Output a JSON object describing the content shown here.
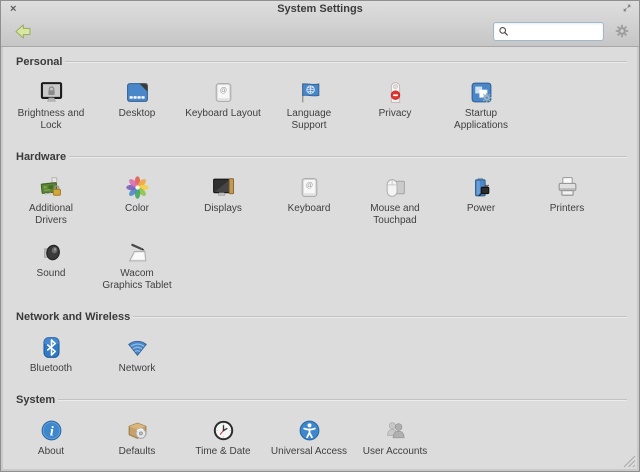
{
  "window": {
    "title": "System Settings",
    "close_glyph": "×"
  },
  "toolbar": {
    "search_value": ""
  },
  "colors": {
    "window_bg": "#dcdcdc",
    "chrome_top": "#dedede",
    "chrome_bottom": "#c6c6c6",
    "header_text": "#3a3a3a",
    "icon_blue": "#4a87c8",
    "privacy_red": "#e3332c",
    "back_arrow_green": "#d8e6a2",
    "search_border": "#9fb8cd"
  },
  "sections": [
    {
      "title": "Personal",
      "rows": [
        [
          {
            "icon": "brightness-lock-icon",
            "label": "Brightness and\nLock"
          },
          {
            "icon": "desktop-icon",
            "label": "Desktop"
          },
          {
            "icon": "keyboard-layout-icon",
            "label": "Keyboard Layout"
          },
          {
            "icon": "language-support-icon",
            "label": "Language\nSupport"
          },
          {
            "icon": "privacy-icon",
            "label": "Privacy"
          },
          {
            "icon": "startup-applications-icon",
            "label": "Startup\nApplications"
          }
        ]
      ]
    },
    {
      "title": "Hardware",
      "rows": [
        [
          {
            "icon": "additional-drivers-icon",
            "label": "Additional\nDrivers"
          },
          {
            "icon": "color-icon",
            "label": "Color"
          },
          {
            "icon": "displays-icon",
            "label": "Displays"
          },
          {
            "icon": "keyboard-icon",
            "label": "Keyboard"
          },
          {
            "icon": "mouse-touchpad-icon",
            "label": "Mouse and\nTouchpad"
          },
          {
            "icon": "power-icon",
            "label": "Power"
          },
          {
            "icon": "printers-icon",
            "label": "Printers"
          }
        ],
        [
          {
            "icon": "sound-icon",
            "label": "Sound"
          },
          {
            "icon": "wacom-icon",
            "label": "Wacom\nGraphics Tablet"
          }
        ]
      ]
    },
    {
      "title": "Network and Wireless",
      "rows": [
        [
          {
            "icon": "bluetooth-icon",
            "label": "Bluetooth"
          },
          {
            "icon": "network-icon",
            "label": "Network"
          }
        ]
      ]
    },
    {
      "title": "System",
      "rows": [
        [
          {
            "icon": "about-icon",
            "label": "About"
          },
          {
            "icon": "defaults-icon",
            "label": "Defaults"
          },
          {
            "icon": "time-date-icon",
            "label": "Time & Date"
          },
          {
            "icon": "universal-access-icon",
            "label": "Universal Access"
          },
          {
            "icon": "user-accounts-icon",
            "label": "User Accounts"
          }
        ]
      ]
    }
  ]
}
